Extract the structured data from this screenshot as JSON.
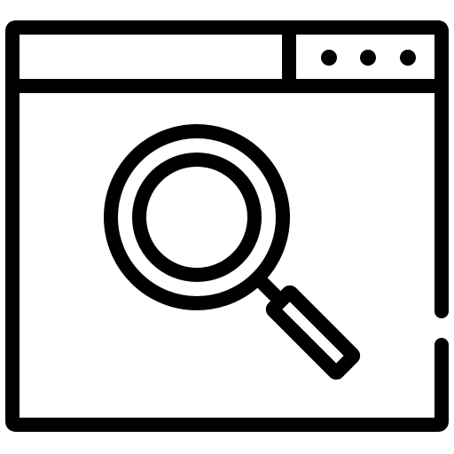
{
  "icon": {
    "name": "browser-window-search-icon",
    "stroke_color": "#000000",
    "background_color": "#ffffff",
    "parts": [
      "browser-window-icon",
      "window-title-bar",
      "window-controls-area",
      "window-control-dots",
      "magnifying-glass-icon"
    ]
  }
}
